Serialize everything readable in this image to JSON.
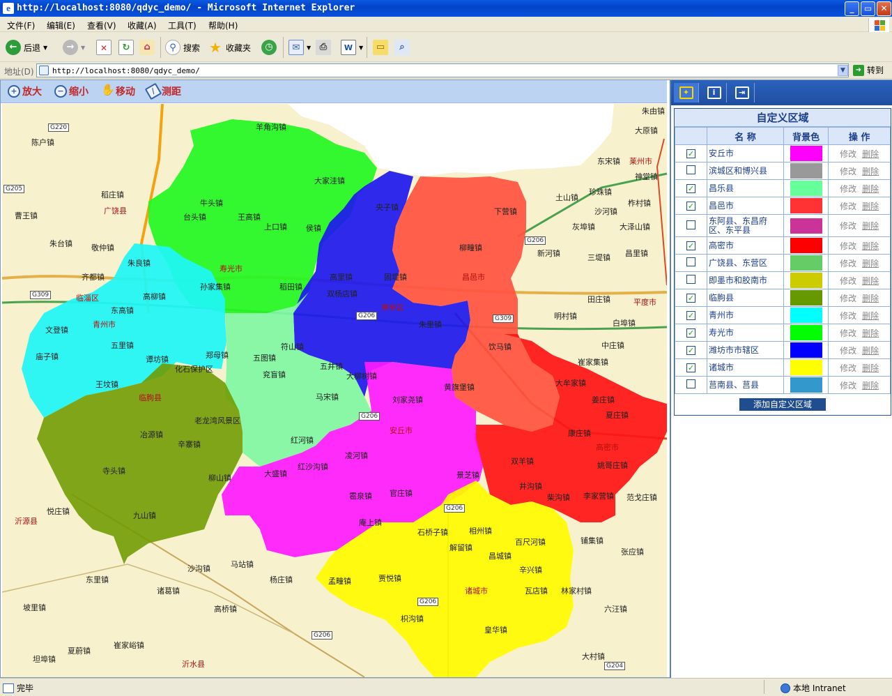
{
  "window": {
    "title": "http://localhost:8080/qdyc_demo/ - Microsoft Internet Explorer",
    "icon_letter": "e",
    "min_icon": "minimize-icon",
    "max_icon": "maximize-icon",
    "close_icon": "close-icon"
  },
  "menu": [
    "文件(F)",
    "编辑(E)",
    "查看(V)",
    "收藏(A)",
    "工具(T)",
    "帮助(H)"
  ],
  "toolbar": {
    "back": "后退",
    "search": "搜索",
    "favorites": "收藏夹"
  },
  "address": {
    "label": "地址(D)",
    "url": "http://localhost:8080/qdyc_demo/",
    "go": "转到"
  },
  "map_tools": [
    {
      "label": "放大",
      "icon": "+"
    },
    {
      "label": "缩小",
      "icon": "−"
    },
    {
      "label": "移动",
      "icon": "✋"
    },
    {
      "label": "测距",
      "icon": "/"
    }
  ],
  "map": {
    "cities": [
      {
        "label": "广饶县"
      },
      {
        "label": "临淄区"
      },
      {
        "label": "青州市"
      },
      {
        "label": "寿光市"
      },
      {
        "label": "寒亭区"
      },
      {
        "label": "昌邑市"
      },
      {
        "label": "安丘市"
      },
      {
        "label": "高密市"
      },
      {
        "label": "诸城市"
      },
      {
        "label": "临朐县"
      },
      {
        "label": "沂源县"
      },
      {
        "label": "沂水县"
      },
      {
        "label": "平度市"
      },
      {
        "label": "莱州市"
      }
    ],
    "towns": [
      {
        "label": "陈户镇"
      },
      {
        "label": "稻庄镇"
      },
      {
        "label": "曹王镇"
      },
      {
        "label": "朱台镇"
      },
      {
        "label": "敬仲镇"
      },
      {
        "label": "齐都镇"
      },
      {
        "label": "羊角沟镇"
      },
      {
        "label": "大家洼镇"
      },
      {
        "label": "牛头镇"
      },
      {
        "label": "台头镇"
      },
      {
        "label": "王高镇"
      },
      {
        "label": "上口镇"
      },
      {
        "label": "侯镇"
      },
      {
        "label": "孙家集镇"
      },
      {
        "label": "稻田镇"
      },
      {
        "label": "央子镇"
      },
      {
        "label": "高里镇"
      },
      {
        "label": "固堤镇"
      },
      {
        "label": "双杨店镇"
      },
      {
        "label": "下营镇"
      },
      {
        "label": "柳疃镇"
      },
      {
        "label": "朱良镇"
      },
      {
        "label": "高柳镇"
      },
      {
        "label": "东高镇"
      },
      {
        "label": "五里镇"
      },
      {
        "label": "谭坊镇"
      },
      {
        "label": "郑母镇"
      },
      {
        "label": "五图镇"
      },
      {
        "label": "符山镇"
      },
      {
        "label": "朱里镇"
      },
      {
        "label": "饮马镇"
      },
      {
        "label": "文登镇"
      },
      {
        "label": "庙子镇"
      },
      {
        "label": "王坟镇"
      },
      {
        "label": "化石保护区"
      },
      {
        "label": "五井镇"
      },
      {
        "label": "兖盲镇"
      },
      {
        "label": "马宋镇"
      },
      {
        "label": "大柳树镇"
      },
      {
        "label": "刘家尧镇"
      },
      {
        "label": "黄旗堡镇"
      },
      {
        "label": "大牟家镇"
      },
      {
        "label": "姜庄镇"
      },
      {
        "label": "夏庄镇"
      },
      {
        "label": "康庄镇"
      },
      {
        "label": "老龙湾风景区"
      },
      {
        "label": "冶源镇"
      },
      {
        "label": "辛寨镇"
      },
      {
        "label": "寺头镇"
      },
      {
        "label": "九山镇"
      },
      {
        "label": "柳山镇"
      },
      {
        "label": "红河镇"
      },
      {
        "label": "大盛镇"
      },
      {
        "label": "红沙沟镇"
      },
      {
        "label": "凌河镇"
      },
      {
        "label": "双羊镇"
      },
      {
        "label": "井沟镇"
      },
      {
        "label": "柴沟镇"
      },
      {
        "label": "姚哥庄镇"
      },
      {
        "label": "景芝镇"
      },
      {
        "label": "雹泉镇"
      },
      {
        "label": "官庄镇"
      },
      {
        "label": "庵上镇"
      },
      {
        "label": "石桥子镇"
      },
      {
        "label": "相州镇"
      },
      {
        "label": "解留镇"
      },
      {
        "label": "昌城镇"
      },
      {
        "label": "百尺河镇"
      },
      {
        "label": "辛兴镇"
      },
      {
        "label": "瓦店镇"
      },
      {
        "label": "贾悦镇"
      },
      {
        "label": "孟疃镇"
      },
      {
        "label": "枳沟镇"
      },
      {
        "label": "皇华镇"
      },
      {
        "label": "林家村镇"
      },
      {
        "label": "六汪镇"
      },
      {
        "label": "铺集镇"
      },
      {
        "label": "张应镇"
      },
      {
        "label": "悦庄镇"
      },
      {
        "label": "沙沟镇"
      },
      {
        "label": "马站镇"
      },
      {
        "label": "杨庄镇"
      },
      {
        "label": "东里镇"
      },
      {
        "label": "诸葛镇"
      },
      {
        "label": "高桥镇"
      },
      {
        "label": "坡里镇"
      },
      {
        "label": "崔家峪镇"
      },
      {
        "label": "夏蔚镇"
      },
      {
        "label": "坦埠镇"
      },
      {
        "label": "大村镇"
      },
      {
        "label": "朱由镇"
      },
      {
        "label": "大原镇"
      },
      {
        "label": "东宋镇"
      },
      {
        "label": "神堂镇"
      },
      {
        "label": "土山镇"
      },
      {
        "label": "珍珠镇"
      },
      {
        "label": "柞村镇"
      },
      {
        "label": "沙河镇"
      },
      {
        "label": "灰埠镇"
      },
      {
        "label": "大泽山镇"
      },
      {
        "label": "新河镇"
      },
      {
        "label": "三堤镇"
      },
      {
        "label": "昌里镇"
      },
      {
        "label": "田庄镇"
      },
      {
        "label": "明村镇"
      },
      {
        "label": "白埠镇"
      },
      {
        "label": "中庄镇"
      },
      {
        "label": "崔家集镇"
      },
      {
        "label": "李家营镇"
      },
      {
        "label": "范戈庄镇"
      }
    ],
    "roads": [
      "G220",
      "G205",
      "G309",
      "G206",
      "G309",
      "G206",
      "G206",
      "G206",
      "G206",
      "G206",
      "G204"
    ]
  },
  "panel": {
    "tab_icons": [
      "settings-icon",
      "info-icon",
      "export-icon"
    ],
    "title": "自定义区域",
    "headers": [
      "名  称",
      "背景色",
      "操  作"
    ],
    "edit": "修改",
    "delete": "删除",
    "add_button": "添加自定义区域",
    "rows": [
      {
        "name": "安丘市",
        "checked": true,
        "color": "#ff00ff"
      },
      {
        "name": "滨城区和博兴县",
        "checked": false,
        "color": "#999999"
      },
      {
        "name": "昌乐县",
        "checked": true,
        "color": "#66ff99"
      },
      {
        "name": "昌邑市",
        "checked": true,
        "color": "#ff3333"
      },
      {
        "name": "东阿县、东昌府区、东平县",
        "checked": false,
        "color": "#cc3399"
      },
      {
        "name": "高密市",
        "checked": true,
        "color": "#ff0000"
      },
      {
        "name": "广饶县、东营区",
        "checked": false,
        "color": "#66cc66"
      },
      {
        "name": "即墨市和胶南市",
        "checked": false,
        "color": "#cccc00"
      },
      {
        "name": "临朐县",
        "checked": true,
        "color": "#669900"
      },
      {
        "name": "青州市",
        "checked": true,
        "color": "#00ffff"
      },
      {
        "name": "寿光市",
        "checked": true,
        "color": "#00ff00"
      },
      {
        "name": "潍坊市市辖区",
        "checked": true,
        "color": "#0000ff"
      },
      {
        "name": "诸城市",
        "checked": true,
        "color": "#ffff00"
      },
      {
        "name": "莒南县、莒县",
        "checked": false,
        "color": "#3399cc"
      }
    ]
  },
  "status": {
    "left": "完毕",
    "zone": "本地 Intranet"
  }
}
